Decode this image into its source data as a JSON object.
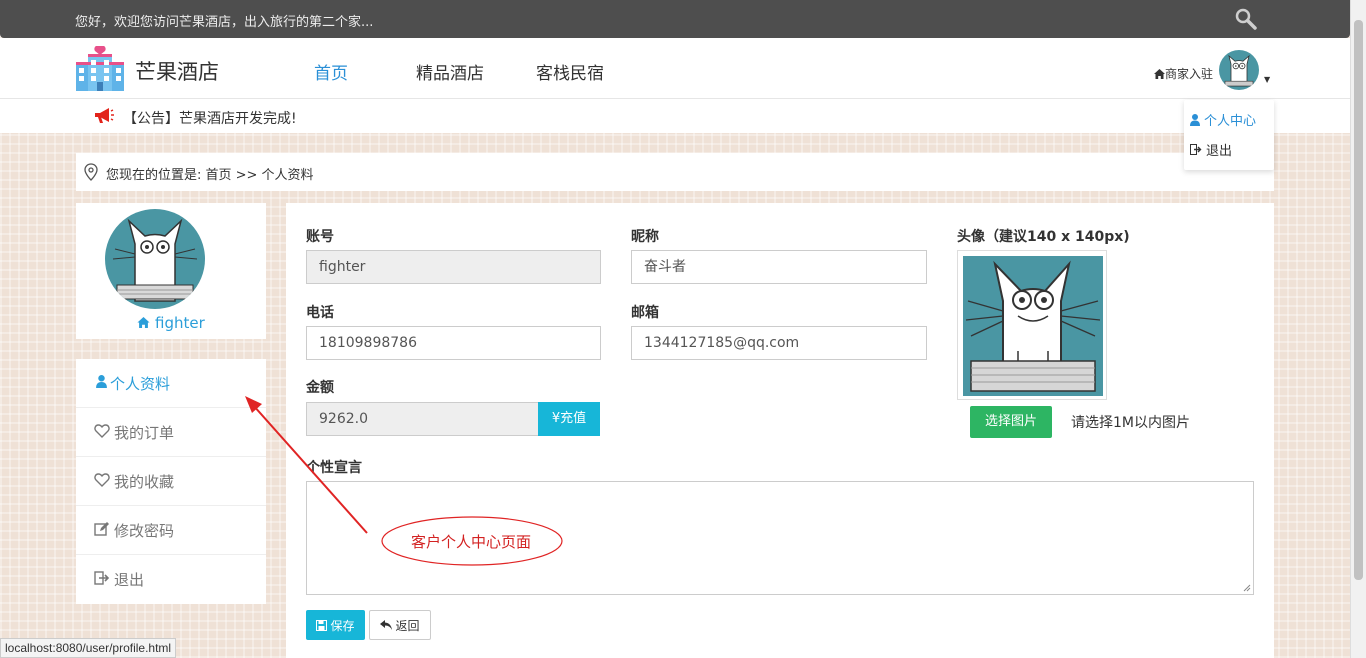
{
  "topbar": {
    "welcome": "您好，欢迎您访问芒果酒店，出入旅行的第二个家..."
  },
  "header": {
    "logo_text": "芒果酒店",
    "nav": [
      "首页",
      "精品酒店",
      "客栈民宿"
    ],
    "merchant": "商家入驻"
  },
  "notice": {
    "text": "【公告】芒果酒店开发完成!"
  },
  "dropdown": {
    "items": [
      "个人中心",
      "退出"
    ]
  },
  "breadcrumb": {
    "text": "您现在的位置是:  首页 >> 个人资料"
  },
  "sidebar": {
    "username": "fighter",
    "menu": [
      "个人资料",
      "我的订单",
      "我的收藏",
      "修改密码",
      "退出"
    ]
  },
  "form": {
    "account_label": "账号",
    "account_value": "fighter",
    "nickname_label": "昵称",
    "nickname_value": "奋斗者",
    "phone_label": "电话",
    "phone_value": "18109898786",
    "email_label": "邮箱",
    "email_value": "1344127185@qq.com",
    "balance_label": "金额",
    "balance_value": "9262.0",
    "recharge_label": "¥充值",
    "avatar_label": "头像（建议140 x 140px)",
    "pick_image_label": "选择图片",
    "pick_image_hint": "请选择1M以内图片",
    "motto_label": "个性宣言",
    "save_label": "保存",
    "back_label": "返回"
  },
  "annotation": {
    "text": "客户个人中心页面",
    "color": "#d32222"
  },
  "status_bar": {
    "url": "localhost:8080/user/profile.html"
  },
  "colors": {
    "accent": "#2a8fd6",
    "cyan_button": "#17b6d8",
    "green_button": "#2db563",
    "topbar": "#4e4e4e"
  }
}
